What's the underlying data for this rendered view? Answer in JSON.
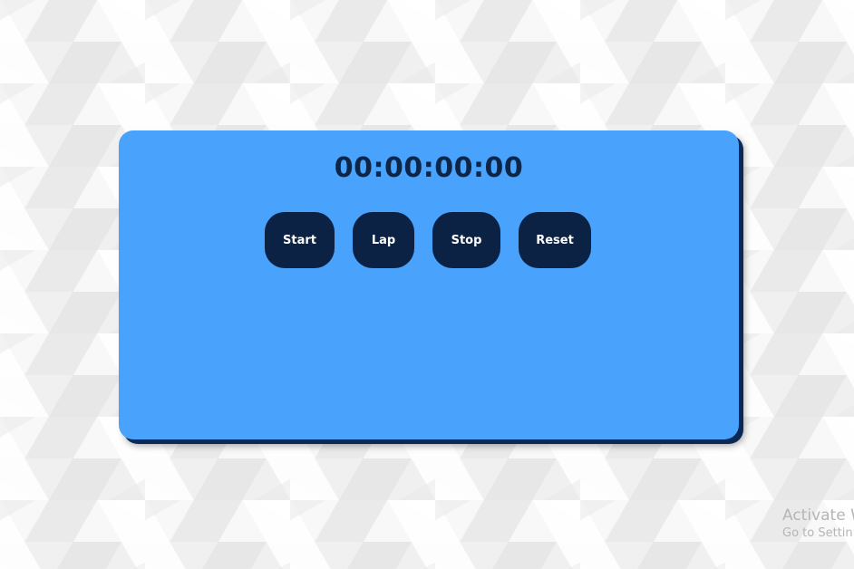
{
  "stopwatch": {
    "time": "00:00:00:00",
    "buttons": {
      "start": "Start",
      "lap": "Lap",
      "stop": "Stop",
      "reset": "Reset"
    },
    "laps": []
  },
  "watermark": {
    "title": "Activate W",
    "subtitle": "Go to Settin"
  },
  "colors": {
    "card": "#49a3fd",
    "button": "#0b2244",
    "time_text": "#0d2547",
    "card_shadow": "#0a2a55"
  }
}
